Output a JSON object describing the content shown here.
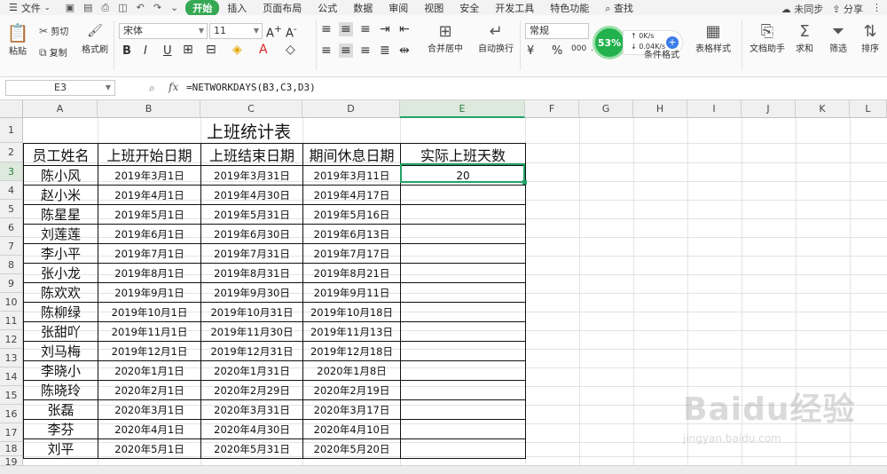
{
  "menu": {
    "file": "文件",
    "tabs": [
      "开始",
      "插入",
      "页面布局",
      "公式",
      "数据",
      "审阅",
      "视图",
      "安全",
      "开发工具",
      "特色功能"
    ],
    "active_tab": "开始",
    "search": "查找",
    "sync": "未同步",
    "share": "分享"
  },
  "ribbon": {
    "paste": "粘贴",
    "cut": "剪切",
    "copy": "复制",
    "format_painter": "格式刷",
    "font_name": "宋体",
    "font_size": "11",
    "merge_center": "合并居中",
    "wrap_text": "自动换行",
    "number_format": "常规",
    "conditional_format": "条件格式",
    "table_style": "表格样式",
    "doc_assistant": "文档助手",
    "sum": "求和",
    "filter": "筛选",
    "sort": "排序",
    "progress_percent": "53%",
    "net_up": "0K/s",
    "net_down": "0.04K/s"
  },
  "formula_bar": {
    "cell_ref": "E3",
    "fx": "fx",
    "formula": "=NETWORKDAYS(B3,C3,D3)"
  },
  "columns": [
    "A",
    "B",
    "C",
    "D",
    "E",
    "F",
    "G",
    "H",
    "I",
    "J",
    "K",
    "L"
  ],
  "rows": [
    "1",
    "2",
    "3",
    "4",
    "5",
    "6",
    "7",
    "8",
    "9",
    "10",
    "11",
    "12",
    "13",
    "14",
    "15",
    "16",
    "17",
    "18",
    "19"
  ],
  "sheet": {
    "title": "上班统计表",
    "headers": [
      "员工姓名",
      "上班开始日期",
      "上班结束日期",
      "期间休息日期",
      "实际上班天数"
    ],
    "records": [
      [
        "陈小风",
        "2019年3月1日",
        "2019年3月31日",
        "2019年3月11日",
        "20"
      ],
      [
        "赵小米",
        "2019年4月1日",
        "2019年4月30日",
        "2019年4月17日",
        ""
      ],
      [
        "陈星星",
        "2019年5月1日",
        "2019年5月31日",
        "2019年5月16日",
        ""
      ],
      [
        "刘莲莲",
        "2019年6月1日",
        "2019年6月30日",
        "2019年6月13日",
        ""
      ],
      [
        "李小平",
        "2019年7月1日",
        "2019年7月31日",
        "2019年7月17日",
        ""
      ],
      [
        "张小龙",
        "2019年8月1日",
        "2019年8月31日",
        "2019年8月21日",
        ""
      ],
      [
        "陈欢欢",
        "2019年9月1日",
        "2019年9月30日",
        "2019年9月11日",
        ""
      ],
      [
        "陈柳绿",
        "2019年10月1日",
        "2019年10月31日",
        "2019年10月18日",
        ""
      ],
      [
        "张甜吖",
        "2019年11月1日",
        "2019年11月30日",
        "2019年11月13日",
        ""
      ],
      [
        "刘马梅",
        "2019年12月1日",
        "2019年12月31日",
        "2019年12月18日",
        ""
      ],
      [
        "李晓小",
        "2020年1月1日",
        "2020年1月31日",
        "2020年1月8日",
        ""
      ],
      [
        "陈晓玲",
        "2020年2月1日",
        "2020年2月29日",
        "2020年2月19日",
        ""
      ],
      [
        "张磊",
        "2020年3月1日",
        "2020年3月31日",
        "2020年3月17日",
        ""
      ],
      [
        "李芬",
        "2020年4月1日",
        "2020年4月30日",
        "2020年4月10日",
        ""
      ],
      [
        "刘平",
        "2020年5月1日",
        "2020年5月31日",
        "2020年5月20日",
        ""
      ]
    ]
  },
  "watermark": {
    "brand": "Baidu经验",
    "url": "jingyan.baidu.com"
  }
}
